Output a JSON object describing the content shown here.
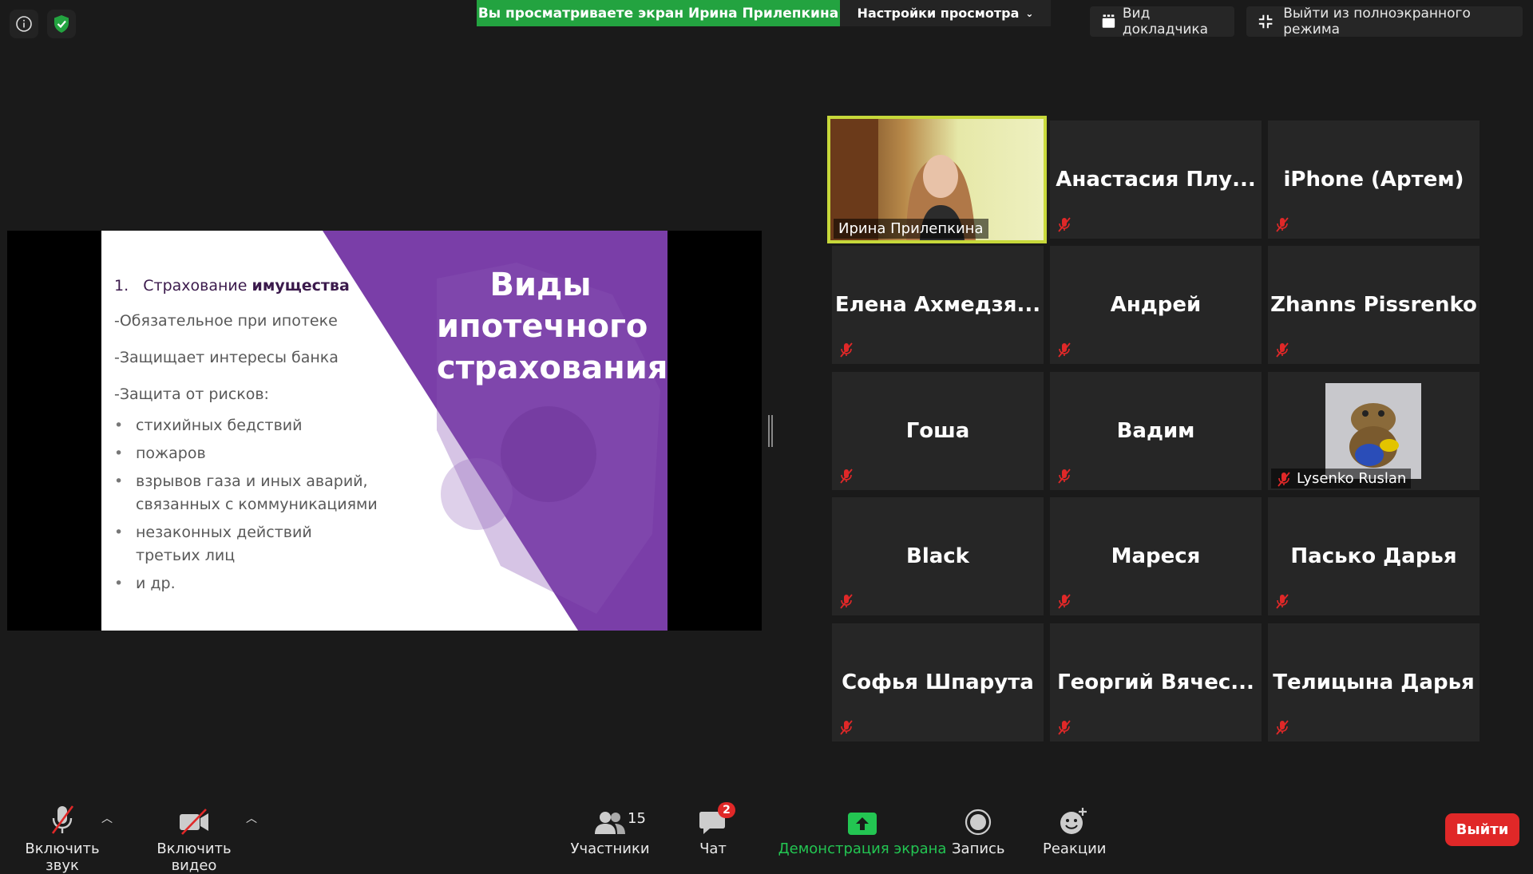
{
  "banner": {
    "viewing_text": "Вы просматриваете экран Ирина Прилепкина",
    "view_options": "Настройки просмотра"
  },
  "top_buttons": {
    "speaker_view": "Вид докладчика",
    "exit_fullscreen": "Выйти из полноэкранного режима"
  },
  "slide": {
    "title_lines": [
      "Виды",
      "ипотечного",
      "страхования"
    ],
    "item_number": "1.",
    "item_text": "Страхование",
    "item_bold": "имущества",
    "lines": [
      "-Обязательное при ипотеке",
      "-Защищает интересы банка",
      "-Защита от рисков:"
    ],
    "bullets": [
      "стихийных бедствий",
      "пожаров",
      "взрывов газа и иных аварий, связанных с коммуникациями",
      "незаконных действий третьих лиц",
      "и др."
    ],
    "accent_color": "#7a3ea8"
  },
  "participants": [
    {
      "name": "Ирина Прилепкина",
      "video": true,
      "active": true
    },
    {
      "name": "Анастасия  Плу...",
      "muted": true
    },
    {
      "name": "iPhone (Артем)",
      "muted": true
    },
    {
      "name": "Елена  Ахмедзя...",
      "muted": true
    },
    {
      "name": "Андрей",
      "muted": true
    },
    {
      "name": "Zhanns Pissrenko",
      "muted": true
    },
    {
      "name": "Гоша",
      "muted": true
    },
    {
      "name": "Вадим",
      "muted": true
    },
    {
      "name": "Lysenko Ruslan",
      "muted": true,
      "avatar": true
    },
    {
      "name": "Black",
      "muted": true
    },
    {
      "name": "Мареся",
      "muted": true
    },
    {
      "name": "Пасько Дарья",
      "muted": true
    },
    {
      "name": "Софья Шпарута",
      "muted": true
    },
    {
      "name": "Георгий  Вячес...",
      "muted": true
    },
    {
      "name": "Телицына Дарья",
      "muted": true
    }
  ],
  "toolbar": {
    "unmute": "Включить звук",
    "start_video": "Включить видео",
    "participants": "Участники",
    "participants_count": "15",
    "chat": "Чат",
    "chat_badge": "2",
    "share_screen": "Демонстрация экрана",
    "record": "Запись",
    "reactions": "Реакции",
    "leave": "Выйти",
    "share_color": "#23c552"
  }
}
